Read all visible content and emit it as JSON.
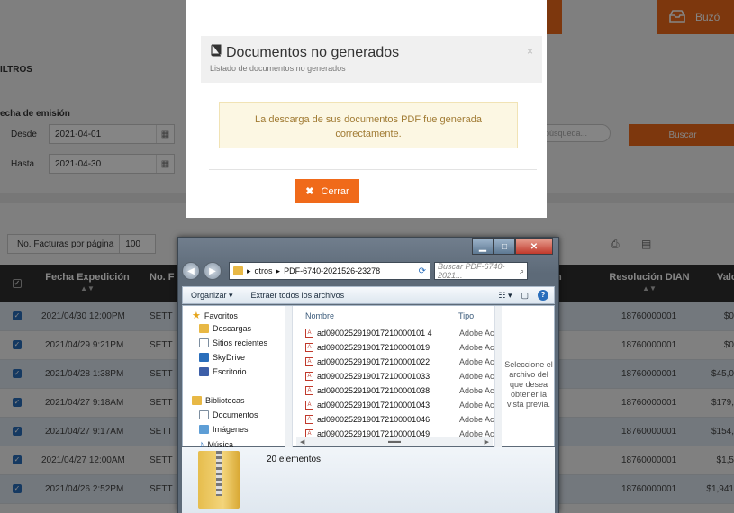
{
  "page": {
    "buzon_label": "Buzó",
    "filters_title": "ILTROS",
    "date_label": "echa de emisión",
    "desde_label": "Desde",
    "desde_value": "2021-04-01",
    "hasta_label": "Hasta",
    "hasta_value": "2021-04-30",
    "search_placeholder": "búsqueda...",
    "buscar_label": "Buscar",
    "perpage_label": "No. Facturas por página",
    "perpage_value": "100"
  },
  "grid": {
    "headers": {
      "fecha": "Fecha Expedición",
      "numero": "No. F",
      "resolucion": "Resolución DIAN",
      "valor": "Valo",
      "partial": "n"
    },
    "rows": [
      {
        "fecha": "2021/04/30 12:00PM",
        "num": "SETT",
        "resolucion": "18760000001",
        "valor": "$0"
      },
      {
        "fecha": "2021/04/29 9:21PM",
        "num": "SETT",
        "resolucion": "18760000001",
        "valor": "$0"
      },
      {
        "fecha": "2021/04/28 1:38PM",
        "num": "SETT",
        "resolucion": "18760000001",
        "valor": "$45,0"
      },
      {
        "fecha": "2021/04/27 9:18AM",
        "num": "SETT",
        "resolucion": "18760000001",
        "valor": "$179,"
      },
      {
        "fecha": "2021/04/27 9:17AM",
        "num": "SETT",
        "resolucion": "18760000001",
        "valor": "$154,"
      },
      {
        "fecha": "2021/04/27 12:00AM",
        "num": "SETT",
        "resolucion": "18760000001",
        "valor": "$1,5"
      },
      {
        "fecha": "2021/04/26 2:52PM",
        "num": "SETT",
        "resolucion": "18760000001",
        "valor": "$1,941"
      }
    ]
  },
  "modal": {
    "title": "Documentos no generados",
    "subtitle": "Listado de documentos no generados",
    "close_symbol": "×",
    "message": "La descarga de sus documentos PDF fue generada correctamente.",
    "cerrar_label": "Cerrar"
  },
  "explorer": {
    "path_parts": [
      "otros",
      "PDF-6740-2021526-23278"
    ],
    "search_placeholder": "Buscar PDF-6740-2021...",
    "toolbar": {
      "organize": "Organizar ▾",
      "extract": "Extraer todos los archivos"
    },
    "nav": {
      "favorites": "Favoritos",
      "descargas": "Descargas",
      "sitios": "Sitios recientes",
      "skydrive": "SkyDrive",
      "escritorio": "Escritorio",
      "bibliotecas": "Bibliotecas",
      "documentos": "Documentos",
      "imagenes": "Imágenes",
      "musica": "Música"
    },
    "columns": {
      "name": "Nombre",
      "type": "Tipo"
    },
    "files": [
      "ad0900252919017210000101 4",
      "ad09002529190172100001019",
      "ad09002529190172100001022",
      "ad09002529190172100001033",
      "ad09002529190172100001038",
      "ad09002529190172100001043",
      "ad09002529190172100001046",
      "ad09002529190172100001049"
    ],
    "file_type": "Adobe Acr",
    "preview_text": "Seleccione el archivo del que desea obtener la vista previa.",
    "item_count": "20 elementos"
  },
  "colors": {
    "accent": "#f06a1a",
    "alert_bg": "#fcf7e3",
    "alert_text": "#a07a32"
  }
}
